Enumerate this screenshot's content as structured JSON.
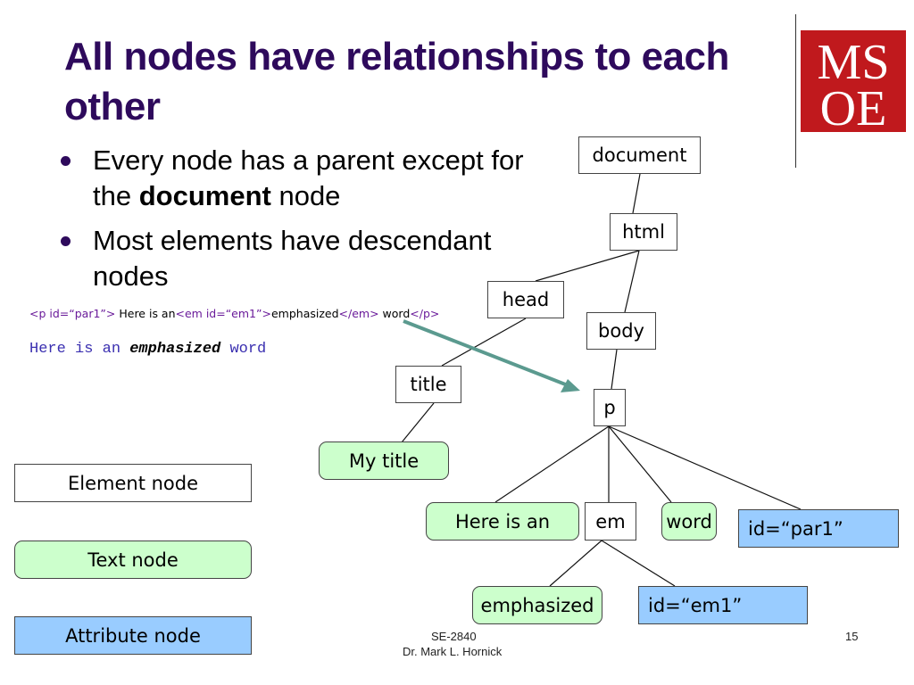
{
  "slide": {
    "title": "All nodes have relationships to each other",
    "bullets": [
      {
        "pre": "Every node has a parent except for the ",
        "bold": "document",
        "post": " node"
      },
      {
        "pre": "Most elements have descendant nodes",
        "bold": "",
        "post": ""
      }
    ],
    "logo_text": {
      "top": "MS",
      "bottom": "OE"
    },
    "code": {
      "p_open": "<p id=“par1”>",
      "text1": " Here is an",
      "em_open": "<em id=“em1”>",
      "text2": "emphasized",
      "em_close": "</em>",
      "text3": " word",
      "p_close": "</p>"
    },
    "rendered": {
      "pre": "Here is an ",
      "em": "emphasized",
      "post": " word"
    },
    "tree_nodes": {
      "document": "document",
      "html": "html",
      "head": "head",
      "body": "body",
      "title": "title",
      "p": "p",
      "my_title": "My title",
      "here_is_an": "Here is an",
      "em": "em",
      "word": "word",
      "id_par1": "id=“par1”",
      "emphasized": "emphasized",
      "id_em1": "id=“em1”"
    },
    "legend": {
      "element": "Element node",
      "text": "Text node",
      "attribute": "Attribute node"
    },
    "colors": {
      "title": "#2e0a5c",
      "text_node": "#ccffcc",
      "attribute_node": "#99ccff",
      "element_node": "#ffffff",
      "arrow": "#5b9a8f",
      "logo": "#c0191d"
    },
    "footer": {
      "course": "SE-2840",
      "author": "Dr. Mark L. Hornick",
      "page": "15"
    }
  }
}
